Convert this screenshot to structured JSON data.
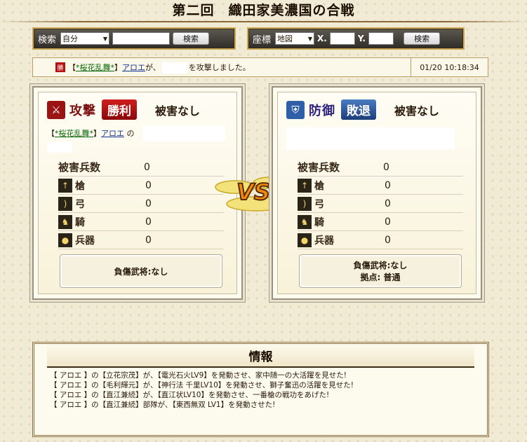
{
  "header": {
    "title": "第二回　織田家美濃国の合戦"
  },
  "search": {
    "label": "検索",
    "scope": "自分",
    "button": "検索"
  },
  "coords": {
    "label": "座標",
    "map": "地図",
    "x_label": "X.",
    "y_label": "Y.",
    "button": "検索"
  },
  "log": {
    "badge": "勝",
    "alliance": "*桜花乱舞*",
    "player": "アロエ",
    "text_pre": "が、",
    "text_post": "を攻撃しました。",
    "timestamp": "01/20 10:18:34"
  },
  "attacker": {
    "role": "攻撃",
    "result": "勝利",
    "damage_label": "被害なし",
    "alliance": "*桜花乱舞*",
    "player": "アロエ",
    "suffix": "の",
    "total_label": "被害兵数",
    "total_value": "0",
    "units": [
      {
        "name": "槍",
        "icon": "spear-icon",
        "value": "0"
      },
      {
        "name": "弓",
        "icon": "bow-icon",
        "value": "0"
      },
      {
        "name": "騎",
        "icon": "horse-icon",
        "value": "0"
      },
      {
        "name": "兵器",
        "icon": "siege-weapon-icon",
        "value": "0"
      }
    ],
    "injured": "負傷武将:なし"
  },
  "defender": {
    "role": "防御",
    "result": "敗退",
    "damage_label": "被害なし",
    "total_label": "被害兵数",
    "total_value": "0",
    "units": [
      {
        "name": "槍",
        "icon": "spear-icon",
        "value": "0"
      },
      {
        "name": "弓",
        "icon": "bow-icon",
        "value": "0"
      },
      {
        "name": "騎",
        "icon": "horse-icon",
        "value": "0"
      },
      {
        "name": "兵器",
        "icon": "siege-weapon-icon",
        "value": "0"
      }
    ],
    "injured": "負傷武将:なし",
    "base": "拠点: 普通"
  },
  "vs_label": "VS",
  "info": {
    "title": "情報",
    "lines": [
      "【 アロエ 】の【立花宗茂】が、【電光石火LV9】を発動させ、家中随一の大活躍を見せた!",
      "【 アロエ 】の【毛利輝元】が、【神行法 千里LV10】を発動させ、獅子奮迅の活躍を見せた!",
      "【 アロエ 】の【直江兼続】が、【直江状LV10】を発動させ、一番槍の戦功をあげた!",
      "【 アロエ 】の【直江兼続】部隊が、【東西無双 LV1】を発動させた!"
    ]
  },
  "colors": {
    "win": "#b80f0f",
    "lose": "#2f5fa6",
    "frame": "#c9a85a"
  }
}
